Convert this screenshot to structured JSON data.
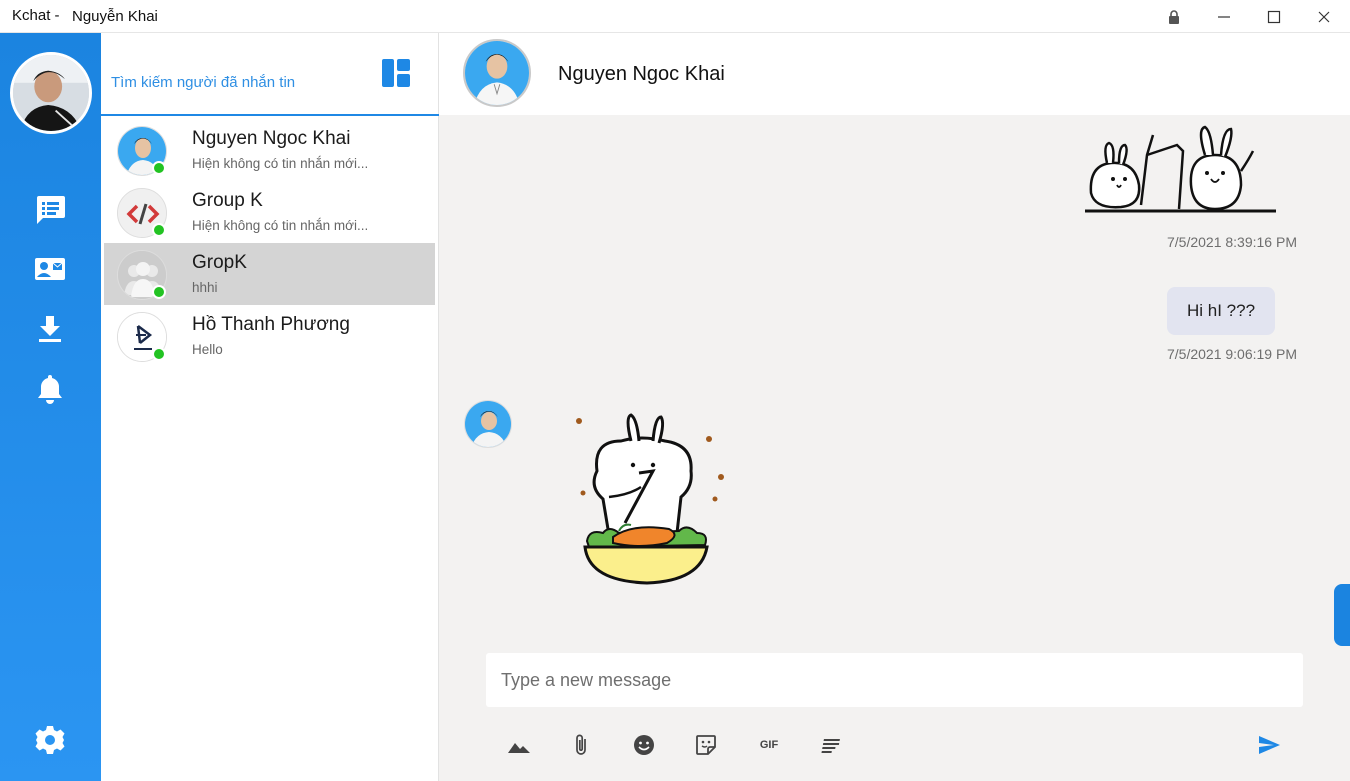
{
  "window": {
    "app_name": "Kchat -",
    "user_name": "Nguyễn Khai"
  },
  "sidebar": {
    "items": [
      {
        "icon": "chat-list-icon"
      },
      {
        "icon": "contact-card-icon"
      },
      {
        "icon": "download-icon"
      },
      {
        "icon": "bell-icon"
      }
    ],
    "settings_icon": "gear-icon",
    "accent": "#1b84e0"
  },
  "search": {
    "placeholder": "Tìm kiếm người đã nhắn tin"
  },
  "conversations": [
    {
      "name": "Nguyen Ngoc Khai",
      "preview": "Hiện không có tin nhắn mới...",
      "online": true,
      "active": false
    },
    {
      "name": "Group K",
      "preview": "Hiện không có tin nhắn mới...",
      "online": true,
      "active": false
    },
    {
      "name": "GropK",
      "preview": "hhhi",
      "online": true,
      "active": true
    },
    {
      "name": "Hồ Thanh Phương",
      "preview": "Hello",
      "online": true,
      "active": false
    }
  ],
  "chat": {
    "title": "Nguyen Ngoc Khai",
    "messages": [
      {
        "type": "sticker",
        "direction": "outgoing",
        "time": "7/5/2021 8:39:16 PM"
      },
      {
        "type": "text",
        "direction": "outgoing",
        "text": "Hi hI ???",
        "time": "7/5/2021 9:06:19 PM"
      },
      {
        "type": "sticker",
        "direction": "incoming"
      }
    ],
    "composer_placeholder": "Type a new message",
    "toolbar": {
      "gif_label": "GIF",
      "icons": [
        "image-icon",
        "attachment-icon",
        "emoji-icon",
        "sticker-icon",
        "gif-icon",
        "format-icon",
        "send-icon"
      ]
    },
    "colors": {
      "background": "#f3f2f1",
      "bubble": "#e2e4f0",
      "online": "#22c322"
    }
  }
}
